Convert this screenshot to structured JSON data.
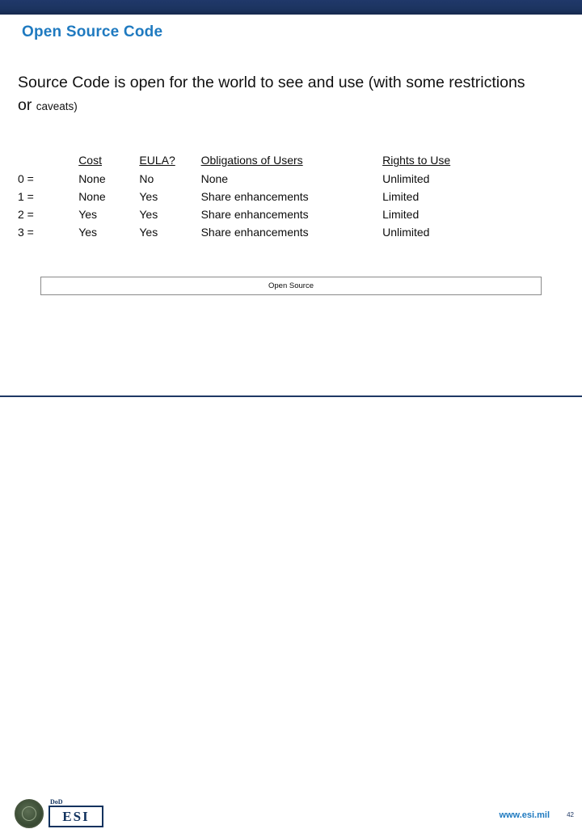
{
  "slide": {
    "title": "Open Source Code",
    "body_main": "Source Code is open for the world to see and use (with some restrictions  or ",
    "body_small": "caveats)",
    "page_number": "42"
  },
  "table": {
    "headers": [
      "",
      "Cost",
      "EULA?",
      "Obligations of Users",
      "Rights to Use"
    ],
    "rows": [
      {
        "key": "0 =",
        "cost": "None",
        "eula": "No",
        "obligations": "None",
        "rights": "Unlimited"
      },
      {
        "key": "1 =",
        "cost": "None",
        "eula": "Yes",
        "obligations": "Share enhancements",
        "rights": "Limited"
      },
      {
        "key": "2 =",
        "cost": "Yes",
        "eula": "Yes",
        "obligations": "Share enhancements",
        "rights": "Limited"
      },
      {
        "key": "3 =",
        "cost": "Yes",
        "eula": "Yes",
        "obligations": "Share enhancements",
        "rights": "Unlimited"
      }
    ]
  },
  "bar": {
    "label": "Open Source"
  },
  "footer": {
    "seal_name": "dod-seal",
    "logo_dod": "DoD",
    "logo_esi": "ESI",
    "url": "www.esi.mil"
  },
  "colors": {
    "title_blue": "#1f7ac0",
    "navy": "#1f3864",
    "text": "#111111"
  }
}
